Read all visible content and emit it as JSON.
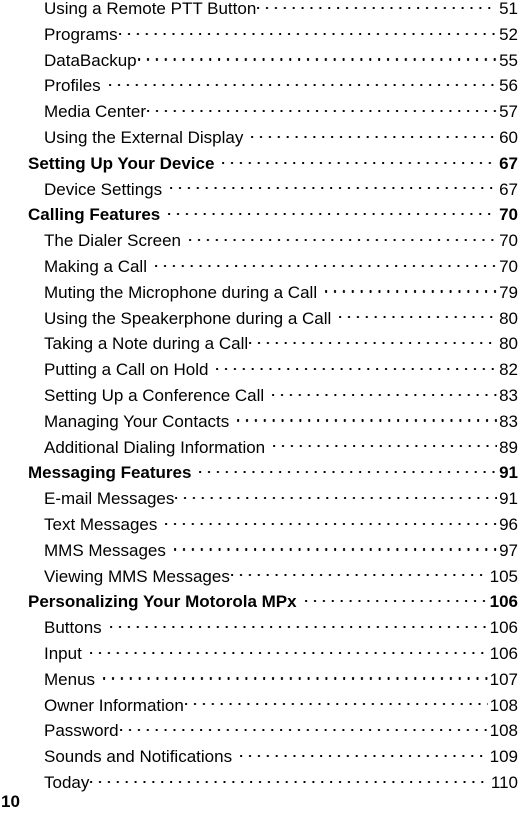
{
  "document": {
    "type": "table-of-contents",
    "folio": "10",
    "leader_char": ".",
    "text_color": "#000000",
    "background_color": "#ffffff"
  },
  "toc": {
    "entries": [
      {
        "title": "Using a Remote PTT Button",
        "page": "51",
        "level": 2,
        "gap_before_leader": false
      },
      {
        "title": "Programs",
        "page": "52",
        "level": 2,
        "gap_before_leader": false
      },
      {
        "title": "DataBackup",
        "page": "55",
        "level": 2,
        "gap_before_leader": false
      },
      {
        "title": "Profiles",
        "page": "56",
        "level": 2,
        "gap_before_leader": true
      },
      {
        "title": "Media Center",
        "page": "57",
        "level": 2,
        "gap_before_leader": false
      },
      {
        "title": "Using the External Display",
        "page": "60",
        "level": 2,
        "gap_before_leader": true
      },
      {
        "title": "Setting Up Your Device",
        "page": "67",
        "level": 1,
        "gap_before_leader": true
      },
      {
        "title": "Device Settings",
        "page": "67",
        "level": 2,
        "gap_before_leader": true
      },
      {
        "title": "Calling Features",
        "page": "70",
        "level": 1,
        "gap_before_leader": true
      },
      {
        "title": "The Dialer Screen",
        "page": "70",
        "level": 2,
        "gap_before_leader": true
      },
      {
        "title": "Making a Call",
        "page": "70",
        "level": 2,
        "gap_before_leader": true
      },
      {
        "title": "Muting the Microphone during a Call",
        "page": "79",
        "level": 2,
        "gap_before_leader": true
      },
      {
        "title": "Using the Speakerphone during a Call",
        "page": "80",
        "level": 2,
        "gap_before_leader": true
      },
      {
        "title": "Taking a Note during a Call",
        "page": "80",
        "level": 2,
        "gap_before_leader": false
      },
      {
        "title": "Putting a Call on Hold",
        "page": "82",
        "level": 2,
        "gap_before_leader": true
      },
      {
        "title": "Setting Up a Conference Call",
        "page": "83",
        "level": 2,
        "gap_before_leader": true
      },
      {
        "title": "Managing Your Contacts",
        "page": "83",
        "level": 2,
        "gap_before_leader": true
      },
      {
        "title": "Additional Dialing Information",
        "page": "89",
        "level": 2,
        "gap_before_leader": true
      },
      {
        "title": "Messaging Features",
        "page": "91",
        "level": 1,
        "gap_before_leader": true
      },
      {
        "title": "E-mail Messages",
        "page": "91",
        "level": 2,
        "gap_before_leader": false
      },
      {
        "title": "Text Messages",
        "page": "96",
        "level": 2,
        "gap_before_leader": true
      },
      {
        "title": "MMS Messages",
        "page": "97",
        "level": 2,
        "gap_before_leader": true
      },
      {
        "title": "Viewing MMS Messages",
        "page": "105",
        "level": 2,
        "gap_before_leader": false
      },
      {
        "title": "Personalizing Your Motorola MPx",
        "page": "106",
        "level": 1,
        "gap_before_leader": true
      },
      {
        "title": "Buttons",
        "page": "106",
        "level": 2,
        "gap_before_leader": true
      },
      {
        "title": "Input",
        "page": "106",
        "level": 2,
        "gap_before_leader": true
      },
      {
        "title": "Menus",
        "page": "107",
        "level": 2,
        "gap_before_leader": true
      },
      {
        "title": "Owner Information",
        "page": "108",
        "level": 2,
        "gap_before_leader": false
      },
      {
        "title": "Password",
        "page": "108",
        "level": 2,
        "gap_before_leader": false
      },
      {
        "title": "Sounds and Notifications",
        "page": "109",
        "level": 2,
        "gap_before_leader": true
      },
      {
        "title": "Today",
        "page": "110",
        "level": 2,
        "gap_before_leader": false
      }
    ]
  }
}
